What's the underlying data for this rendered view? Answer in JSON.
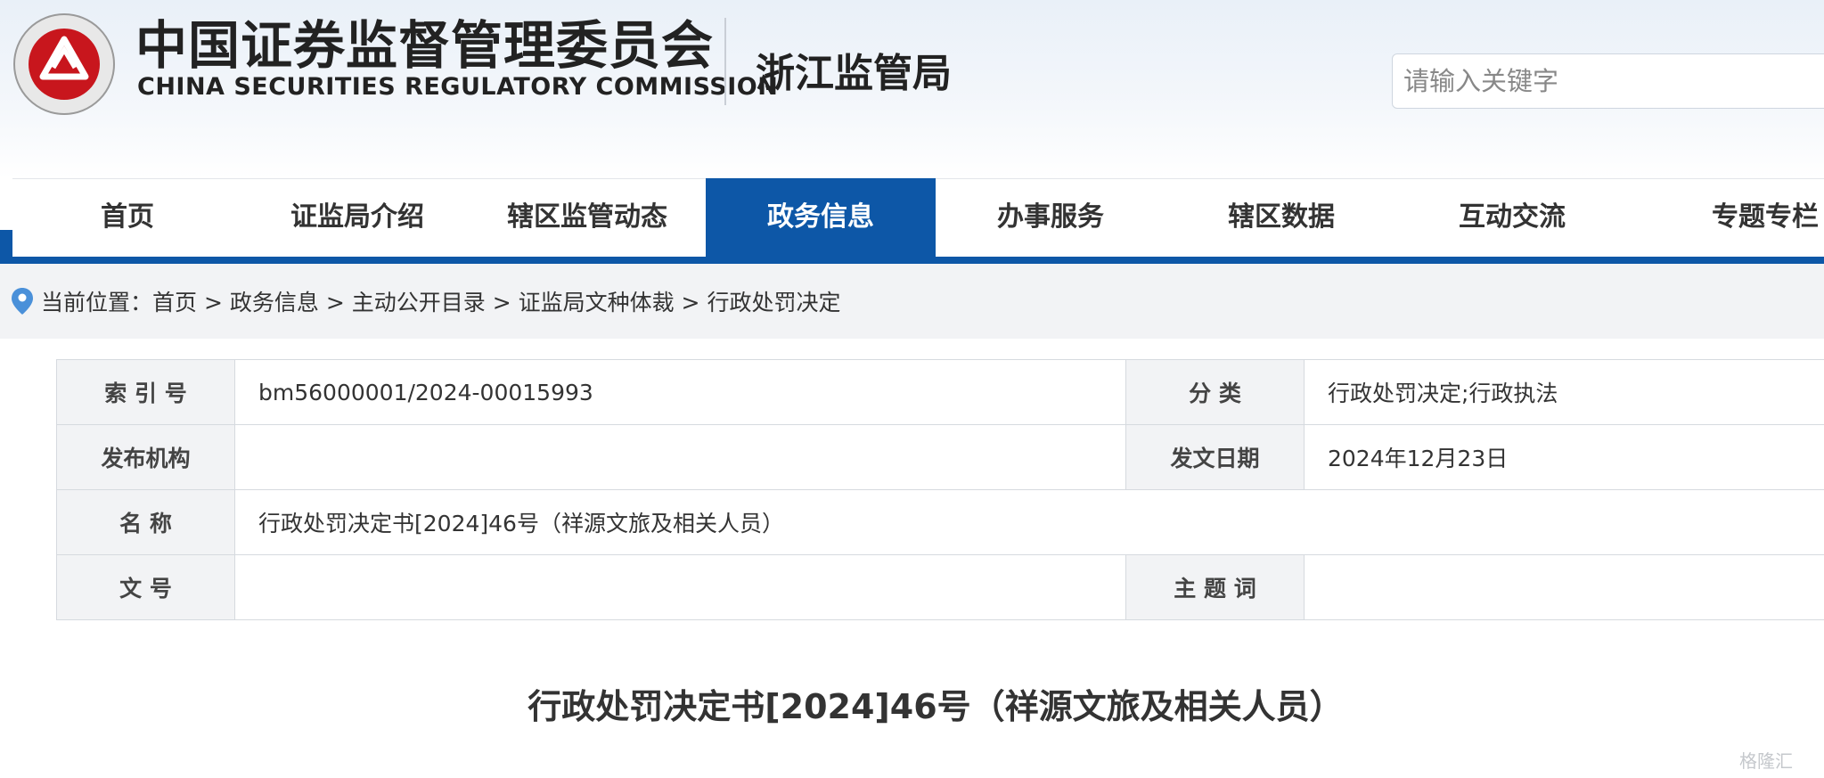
{
  "header": {
    "logo_cn": "中国证券监督管理委员会",
    "logo_en": "CHINA SECURITIES REGULATORY COMMISSION",
    "bureau": "浙江监管局",
    "search_placeholder": "请输入关键字"
  },
  "nav": {
    "items": [
      {
        "label": "首页"
      },
      {
        "label": "证监局介绍"
      },
      {
        "label": "辖区监管动态"
      },
      {
        "label": "政务信息",
        "active": true
      },
      {
        "label": "办事服务"
      },
      {
        "label": "辖区数据"
      },
      {
        "label": "互动交流"
      },
      {
        "label": "专题专栏"
      }
    ],
    "accent_color": "#0d57a7"
  },
  "breadcrumb": {
    "prefix": "当前位置：",
    "path": [
      "首页",
      "政务信息",
      "主动公开目录",
      "证监局文种体裁",
      "行政处罚决定"
    ],
    "separator": " > "
  },
  "meta": {
    "index_label": "索 引 号",
    "index_value": "bm56000001/2024-00015993",
    "category_label": "分 类",
    "category_value": "行政处罚决定;行政执法",
    "publisher_label": "发布机构",
    "publisher_value": "",
    "date_label": "发文日期",
    "date_value": "2024年12月23日",
    "name_label": "名 称",
    "name_value": "行政处罚决定书[2024]46号（祥源文旅及相关人员）",
    "docno_label": "文 号",
    "docno_value": "",
    "keywords_label": "主 题 词",
    "keywords_value": ""
  },
  "document": {
    "title": "行政处罚决定书[2024]46号（祥源文旅及相关人员）"
  },
  "watermark": "格隆汇"
}
